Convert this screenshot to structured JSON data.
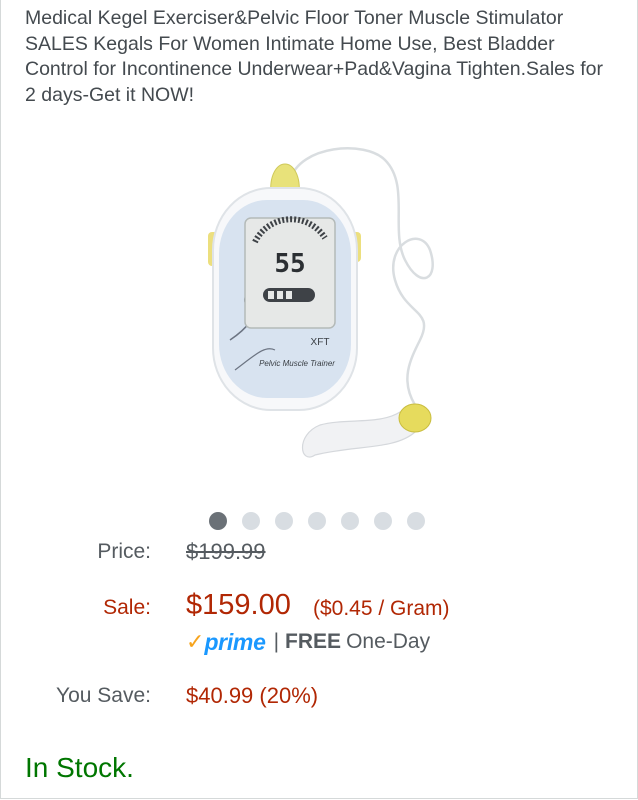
{
  "product": {
    "title": "Medical Kegel Exerciser&Pelvic Floor Toner Muscle Stimulator SALES Kegals For Women Intimate Home Use, Best Bladder Control for Incontinence Underwear+Pad&Vagina Tighten.Sales for 2 days-Get it NOW!"
  },
  "device_screen": {
    "reading": "55",
    "brand": "XFT",
    "script": "Pelvic Muscle Trainer"
  },
  "gallery": {
    "dot_count": 7,
    "active_index": 0
  },
  "pricing": {
    "price_label": "Price:",
    "list_price": "$199.99",
    "sale_label": "Sale:",
    "sale_price": "$159.00",
    "unit_price": "($0.45 / Gram)",
    "prime_check": "✓",
    "prime_word": "prime",
    "separator": "|",
    "free_label": "FREE",
    "shipping_label": "One-Day",
    "save_label": "You Save:",
    "save_value": "$40.99 (20%)"
  },
  "availability": {
    "status": "In Stock."
  },
  "colors": {
    "sale_red": "#b12704",
    "in_stock_green": "#007600",
    "prime_blue": "#1a98ff",
    "prime_orange": "#f7a41d"
  }
}
